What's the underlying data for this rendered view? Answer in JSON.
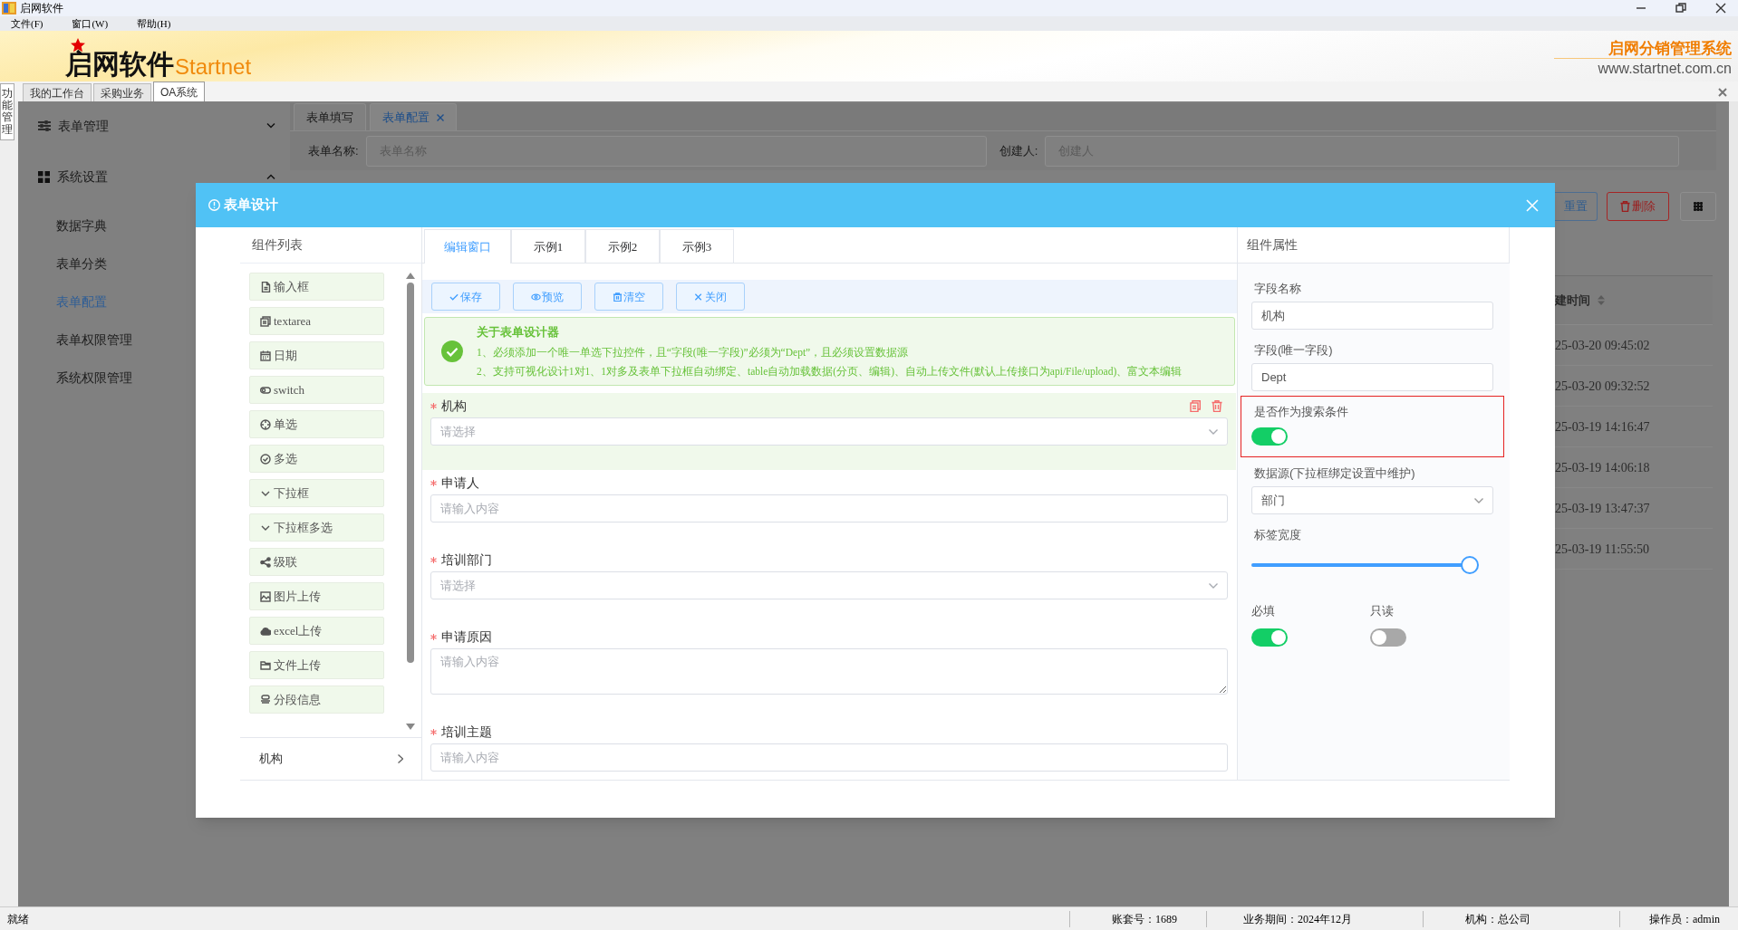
{
  "window": {
    "title": "启网软件"
  },
  "menu": [
    "文件(F)",
    "窗口(W)",
    "帮助(H)"
  ],
  "banner": {
    "logo": "启网软件",
    "logo_latin": "Startnet",
    "system_name": "启网分销管理系统",
    "website": "www.startnet.com.cn"
  },
  "side_tab": "功能管理",
  "workspace_tabs": [
    {
      "label": "我的工作台",
      "selected": false
    },
    {
      "label": "采购业务",
      "selected": false
    },
    {
      "label": "OA系统",
      "selected": true
    }
  ],
  "sidebar": {
    "groups": [
      {
        "label": "表单管理",
        "expanded": false
      },
      {
        "label": "系统设置",
        "expanded": true,
        "children": [
          {
            "label": "数据字典",
            "selected": false
          },
          {
            "label": "表单分类",
            "selected": false
          },
          {
            "label": "表单配置",
            "selected": true
          },
          {
            "label": "表单权限管理",
            "selected": false
          },
          {
            "label": "系统权限管理",
            "selected": false
          }
        ]
      }
    ]
  },
  "page_tabs": [
    {
      "label": "表单填写",
      "selected": false,
      "closable": false
    },
    {
      "label": "表单配置",
      "selected": true,
      "closable": true
    }
  ],
  "search_form": [
    {
      "label": "表单名称:",
      "placeholder": "表单名称"
    },
    {
      "label": "创建人:",
      "placeholder": "创建人"
    }
  ],
  "toolbar_buttons": [
    {
      "kind": "reset",
      "label": "重置"
    },
    {
      "kind": "danger",
      "label": "删除"
    },
    {
      "kind": "grid"
    }
  ],
  "table": {
    "columns": [
      "建时间"
    ],
    "rows": [
      [
        "25-03-20 09:45:02"
      ],
      [
        "25-03-20 09:32:52"
      ],
      [
        "25-03-19 14:16:47"
      ],
      [
        "25-03-19 14:06:18"
      ],
      [
        "25-03-19 13:47:37"
      ],
      [
        "25-03-19 11:55:50"
      ]
    ]
  },
  "dialog": {
    "title": "表单设计",
    "component_list": {
      "title": "组件列表",
      "items": [
        "输入框",
        "textarea",
        "日期",
        "switch",
        "单选",
        "多选",
        "下拉框",
        "下拉框多选",
        "级联",
        "图片上传",
        "excel上传",
        "文件上传",
        "分段信息"
      ],
      "footer": "机构"
    },
    "designer": {
      "tabs": [
        {
          "label": "编辑窗口",
          "selected": true
        },
        {
          "label": "示例1",
          "selected": false
        },
        {
          "label": "示例2",
          "selected": false
        },
        {
          "label": "示例3",
          "selected": false
        }
      ],
      "buttons": [
        "保存",
        "预览",
        "清空",
        "关闭"
      ],
      "notice": {
        "title": "关于表单设计器",
        "lines": [
          "1、必须添加一个唯一单选下拉控件，且“字段(唯一字段)”必须为“Dept”，且必须设置数据源",
          "2、支持可视化设计1对1、1对多及表单下拉框自动绑定、table自动加载数据(分页、编辑)、自动上传文件(默认上传接口为api/File/upload)、富文本编辑"
        ]
      },
      "fields": [
        {
          "kind": "select",
          "label": "机构",
          "placeholder": "请选择",
          "required": true,
          "selected": true
        },
        {
          "kind": "input",
          "label": "申请人",
          "placeholder": "请输入内容",
          "required": true,
          "selected": false
        },
        {
          "kind": "select",
          "label": "培训部门",
          "placeholder": "请选择",
          "required": true,
          "selected": false
        },
        {
          "kind": "textarea",
          "label": "申请原因",
          "placeholder": "请输入内容",
          "required": true,
          "selected": false
        },
        {
          "kind": "input",
          "label": "培训主题",
          "placeholder": "请输入内容",
          "required": true,
          "selected": false
        }
      ]
    },
    "properties": {
      "title": "组件属性",
      "items": [
        {
          "kind": "input",
          "label": "字段名称",
          "value": "机构",
          "highlighted": false
        },
        {
          "kind": "input",
          "label": "字段(唯一字段)",
          "value": "Dept",
          "highlighted": false
        },
        {
          "kind": "switch",
          "label": "是否作为搜索条件",
          "on": true,
          "highlighted": true
        },
        {
          "kind": "select",
          "label": "数据源(下拉框绑定设置中维护)",
          "value": "部门",
          "highlighted": false
        },
        {
          "kind": "slider",
          "label": "标签宽度",
          "level": 1,
          "highlighted": false
        },
        {
          "kind": "switches",
          "highlighted": false,
          "switches": [
            {
              "label": "必填",
              "on": true
            },
            {
              "label": "只读",
              "on": false
            }
          ]
        }
      ]
    }
  },
  "status_bar": [
    "就绪",
    "账套号：1689",
    "业务期间：2024年12月",
    "机构：总公司",
    "操作员：admin"
  ]
}
